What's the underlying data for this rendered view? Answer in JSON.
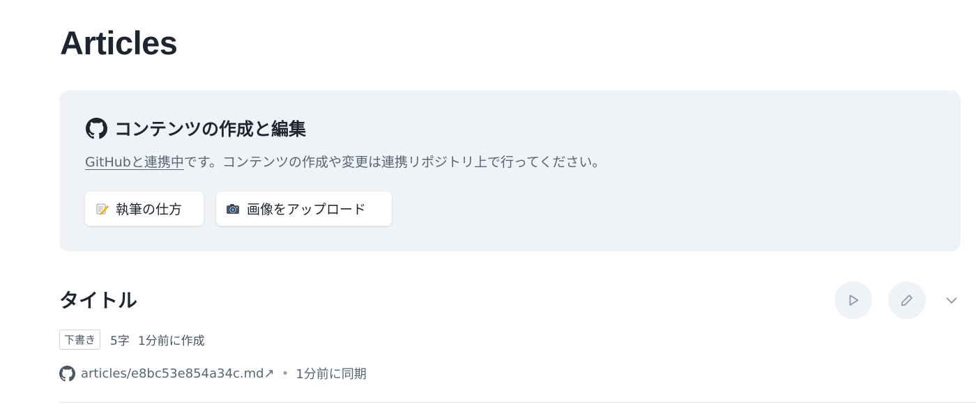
{
  "page": {
    "title": "Articles"
  },
  "info_card": {
    "heading": "コンテンツの作成と編集",
    "heading_icon": "github-icon",
    "description_link": "GitHubと連携中",
    "description_rest": "です。コンテンツの作成や変更は連携リポジトリ上で行ってください。",
    "buttons": [
      {
        "icon": "memo-emoji-icon",
        "label": "執筆の仕方"
      },
      {
        "icon": "camera-emoji-icon",
        "label": "画像をアップロード"
      }
    ]
  },
  "article": {
    "title": "タイトル",
    "status_badge": "下書き",
    "char_count": "5字",
    "created": "1分前に作成",
    "repo_path": "articles/e8bc53e854a34c.md",
    "external_mark": "↗",
    "separator": "•",
    "synced": "1分前に同期",
    "actions": [
      "play-icon",
      "pencil-icon",
      "chevron-down-icon"
    ]
  },
  "colors": {
    "card_bg": "#eff2f6",
    "heading_text": "#1e2530",
    "muted_text": "#5a6574"
  }
}
